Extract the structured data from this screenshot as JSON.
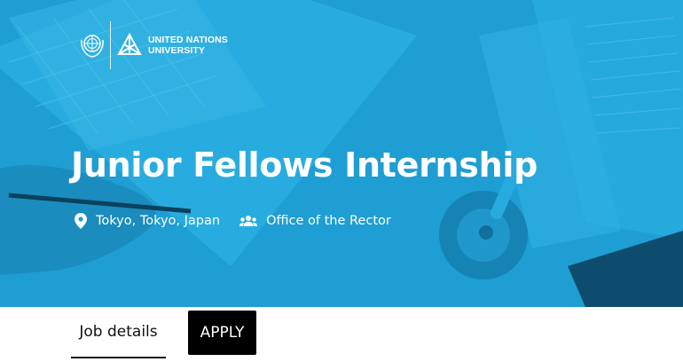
{
  "org": {
    "name_line1": "UNITED NATIONS",
    "name_line2": "UNIVERSITY"
  },
  "hero": {
    "title": "Junior Fellows Internship",
    "background_color": "#1fa0d6",
    "location_icon": "location-pin-icon",
    "location": "Tokyo, Tokyo, Japan",
    "department_icon": "people-icon",
    "department": "Office of the Rector"
  },
  "tabs": {
    "job_details": "Job details",
    "apply": "APPLY"
  }
}
